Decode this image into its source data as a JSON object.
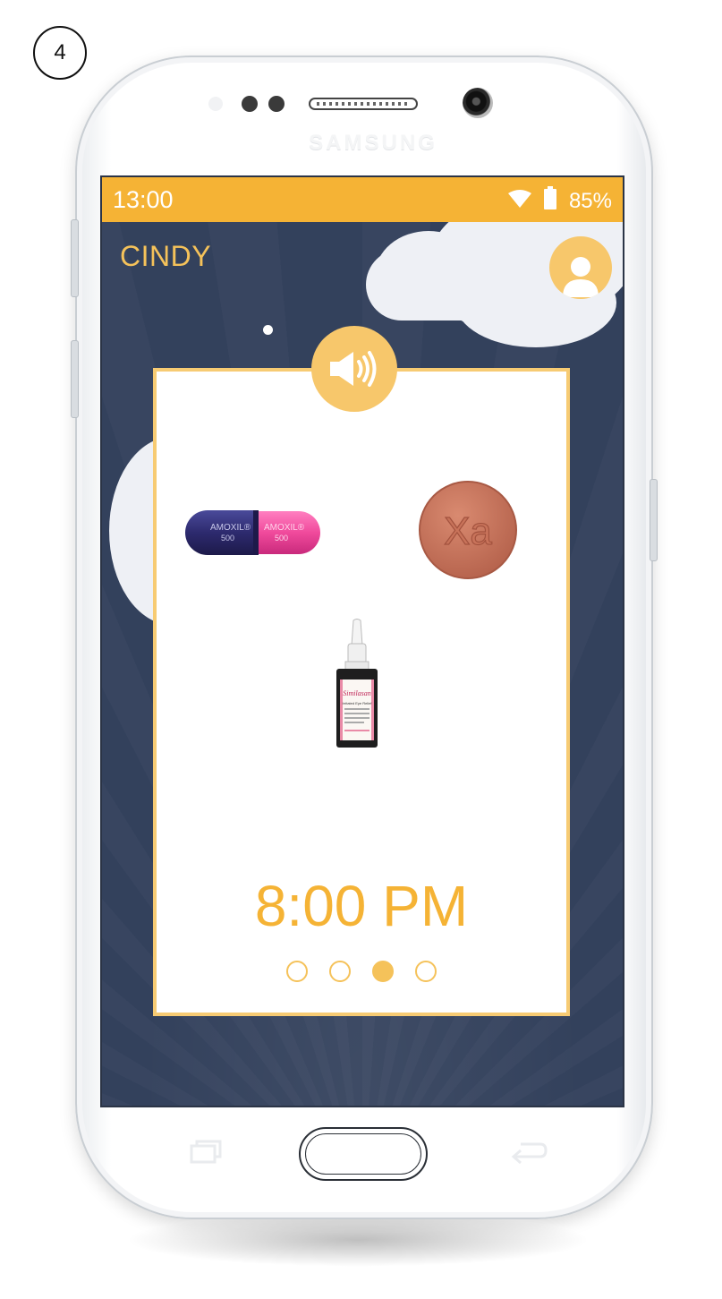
{
  "step": {
    "number": "4"
  },
  "phone": {
    "brand": "SAMSUNG"
  },
  "status_bar": {
    "time": "13:00",
    "battery": "85%",
    "wifi_icon": "wifi-icon",
    "battery_icon": "battery-icon"
  },
  "header": {
    "user_name": "CINDY",
    "avatar_icon": "person-icon"
  },
  "card": {
    "sound_icon": "speaker-volume-icon",
    "medications": [
      {
        "name": "amoxil-capsule",
        "print_1": "AMOXIL®",
        "print_2": "500"
      },
      {
        "name": "xa-tablet",
        "print": "Xa"
      },
      {
        "name": "eye-drops-bottle",
        "brand": "Similasan",
        "line_1": "Irritated Eye Relief"
      }
    ],
    "time": "8:00 PM",
    "pagination": {
      "total": 4,
      "active_index": 2
    }
  },
  "colors": {
    "accent": "#f5b335",
    "accent_light": "#f7c76b",
    "night_sky": "#33415c",
    "card_border": "#f7cb73"
  }
}
